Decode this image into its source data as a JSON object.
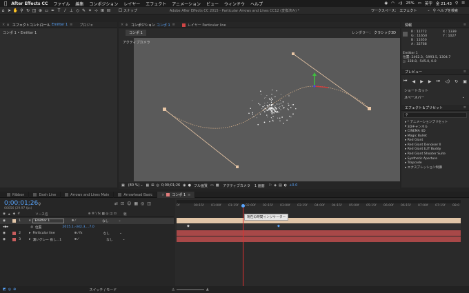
{
  "menubar": {
    "app_name": "After Effects CC",
    "items": [
      "ファイル",
      "編集",
      "コンポジション",
      "レイヤー",
      "エフェクト",
      "アニメーション",
      "ビュー",
      "ウィンドウ",
      "ヘルプ"
    ],
    "battery": "25%",
    "input_method": "英字",
    "clock": "金 21:43"
  },
  "toolbar": {
    "window_title": "Adobe After Effects CC 2015 - Particular Arrows and Lines CC12 (変換済み) *",
    "snap_label": "スナップ",
    "workspace_label": "ワークスペース：",
    "workspace_value": "エフェクト",
    "help_search_placeholder": "ヘルプを検索"
  },
  "effect_controls": {
    "tab_label": "エフェクトコントロール",
    "tab_layer": "Emitter 1",
    "project_tab": "プロジェ",
    "breadcrumb": "コンポ 1 • Emitter 1"
  },
  "composition": {
    "tab_label": "コンポジション",
    "tab_comp": "コンポ 1",
    "layer_tab": "レイヤー  Particular line",
    "sub_tab": "コンポ 1",
    "renderer_label": "レンダラー：",
    "renderer_value": "クラシック3D",
    "camera_label": "アクティブカメラ",
    "zoom": "(80 %)",
    "timecode": "0;00;01;26",
    "quality": "フル画質",
    "view_camera": "アクティブカメラ",
    "view_count": "1 画面",
    "exposure": "+0.0"
  },
  "info_panel": {
    "title": "情報",
    "r_label": "R :",
    "r_value": "11772",
    "g_label": "G :",
    "g_value": "11650",
    "b_label": "B :",
    "b_value": "11650",
    "a_label": "A :",
    "a_value": "32768",
    "x_label": "X :",
    "x_value": "1339",
    "y_label": "Y :",
    "y_value": "1027",
    "layer_name": "Emitter 1",
    "position_line": "位置: 2462.3, -1993.5, 1304.7",
    "delta_line": "△: 338.8, -545.0, 0.0"
  },
  "preview_panel": {
    "title": "プレビュー",
    "shortcut_label": "ショートカット",
    "shortcut_value": "スペースバー"
  },
  "effects_presets": {
    "title": "エフェクト＆プリセット",
    "search_placeholder": "",
    "items": [
      "* アニメーションプリセット",
      "3Dチャンネル",
      "CINEMA 4D",
      "Magic Bullet",
      "Red Giant",
      "Red Giant Denoiser II",
      "Red Giant LUT Buddy",
      "Red Giant Shooter Suite",
      "Synthetic Aperture",
      "Trapcode",
      "エクスプレッション制御"
    ]
  },
  "timeline": {
    "tabs": [
      "Ribbon",
      "Dash Line",
      "Arrows and Lines Main",
      "Arrowhead Basic",
      "コンポ 1"
    ],
    "tab_colors": [
      "#a0a0a0",
      "#a0a0a0",
      "#a0a0a0",
      "#a0a0a0",
      "#e07b7b"
    ],
    "current_time": "0;00;01;26",
    "fps_info": "00056 (29.97 fps)",
    "col_source": "ソース名",
    "col_parent": "親",
    "layers": [
      {
        "num": "1",
        "name": "Emitter 1",
        "color": "#e2c6a8",
        "parent": "なし"
      },
      {
        "num": "",
        "name": "位置",
        "value": "2015.1,-342.3,...7.0",
        "color": "",
        "parent": ""
      },
      {
        "num": "2",
        "name": "Particular line",
        "color": "#c95d5d",
        "parent": "なし"
      },
      {
        "num": "3",
        "name": "濃いグレー 長し...1",
        "color": "#c95d5d",
        "parent": "なし"
      }
    ],
    "ruler_ticks": [
      "0f",
      "00:15f",
      "01:00f",
      "01:15f",
      "02:00f",
      "02:15f",
      "03:00f",
      "03:15f",
      "04:00f",
      "04:15f",
      "05:00f",
      "05:15f",
      "06:00f",
      "06:15f",
      "07:00f",
      "07:15f",
      "08:0"
    ],
    "tooltip": "現在の時間インジケーター",
    "bottom_label": "スイッチ / モード"
  }
}
